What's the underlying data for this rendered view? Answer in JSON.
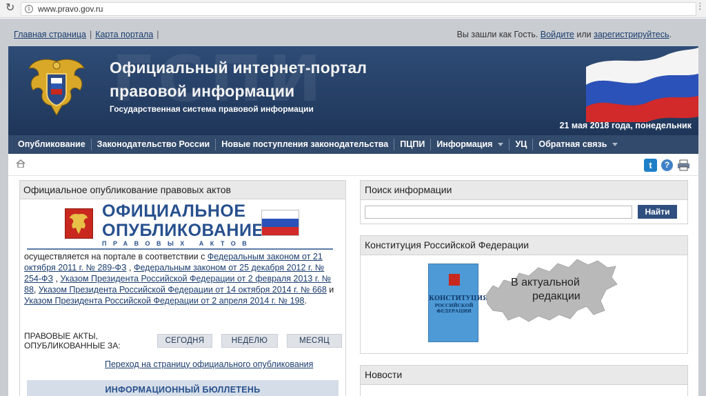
{
  "browser": {
    "url": "www.pravo.gov.ru"
  },
  "topnav": {
    "home": "Главная страница",
    "sitemap": "Карта портала",
    "sep1": "|",
    "sep2": "|"
  },
  "user": {
    "prefix": "Вы зашли как Гость.",
    "login": "Войдите",
    "or": "или",
    "register": "зарегистрируйтесь",
    "dot": "."
  },
  "header": {
    "title_line1": "Официальный интернет-портал",
    "title_line2": "правовой информации",
    "subtitle": "Государственная система правовой информации",
    "date": "21 мая 2018 года, понедельник",
    "watermark": "ГСПИ"
  },
  "mainnav": {
    "items": [
      "Опубликование",
      "Законодательство России",
      "Новые поступления законодательства",
      "ПЦПИ",
      "Информация",
      "УЦ",
      "Обратная связь"
    ]
  },
  "left_panel": {
    "title": "Официальное опубликование правовых актов",
    "logo_line1": "ОФИЦИАЛЬНОЕ",
    "logo_line2": "ОПУБЛИКОВАНИЕ",
    "logo_line3": "ПРАВОВЫХ АКТОВ",
    "text_prefix": "осуществляется на портале в соответствии с ",
    "link1": "Федеральным законом от 21 октября 2011 г. № 289-ФЗ",
    "comma1": " , ",
    "link2": "Федеральным законом от 25 декабря 2012 г. № 254-ФЗ",
    "comma2": " , ",
    "link3": "Указом Президента Российской Федерации от 2 февраля 2013 г. № 88",
    "comma3": ", ",
    "link4": "Указом Президента Российской Федерации от 14 октября 2014 г. № 668",
    "and": " и ",
    "link5": "Указом Президента Российской Федерации от 2 апреля 2014 г. № 198",
    "period": ".",
    "acts_label_line1": "ПРАВОВЫЕ АКТЫ,",
    "acts_label_line2": "ОПУБЛИКОВАННЫЕ ЗА:",
    "btn_today": "СЕГОДНЯ",
    "btn_week": "НЕДЕЛЮ",
    "btn_month": "МЕСЯЦ",
    "goto_link": "Переход на страницу официального опубликования",
    "bulletin": "ИНФОРМАЦИОННЫЙ БЮЛЛЕТЕНЬ"
  },
  "search_panel": {
    "title": "Поиск информации",
    "input_value": "",
    "button": "Найти"
  },
  "constitution_panel": {
    "title": "Конституция Российской Федерации",
    "book_line1": "КОНСТИТУЦИЯ",
    "book_line2": "РОССИЙСКОЙ",
    "book_line3": "ФЕДЕРАЦИИ",
    "map_line1": "В актуальной",
    "map_line2": "редакции"
  },
  "news_panel": {
    "title": "Новости"
  },
  "colors": {
    "header_bg": "#2e4c76",
    "nav_bg": "#324a6b",
    "link": "#1a3c6e",
    "logo_blue": "#27508e",
    "search_btn": "#2f4f7f"
  }
}
